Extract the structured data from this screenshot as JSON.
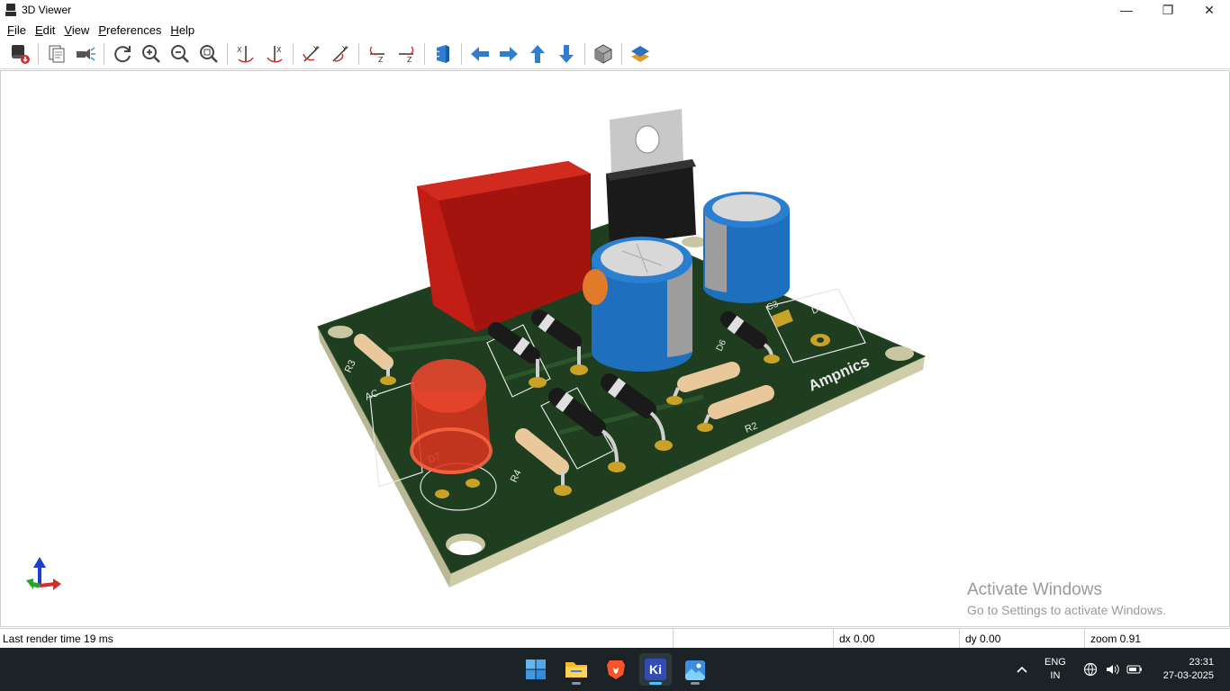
{
  "window": {
    "title": "3D Viewer",
    "controls": {
      "minimize": "—",
      "maximize": "❐",
      "close": "✕"
    }
  },
  "menu": {
    "items": [
      {
        "label": "File",
        "accel": "F",
        "rest": "ile"
      },
      {
        "label": "Edit",
        "accel": "E",
        "rest": "dit"
      },
      {
        "label": "View",
        "accel": "V",
        "rest": "iew"
      },
      {
        "label": "Preferences",
        "accel": "P",
        "rest": "references"
      },
      {
        "label": "Help",
        "accel": "H",
        "rest": "elp"
      }
    ]
  },
  "toolbar": {
    "buttons": [
      "export-icon",
      "copy-icon",
      "raytrace-icon",
      "reload-icon",
      "zoom-in-icon",
      "zoom-out-icon",
      "zoom-fit-icon",
      "rotate-x-cw-icon",
      "rotate-x-ccw-icon",
      "rotate-y-cw-icon",
      "rotate-y-ccw-icon",
      "rotate-z-cw-icon",
      "rotate-z-ccw-icon",
      "flip-board-icon",
      "move-left-icon",
      "move-right-icon",
      "move-up-icon",
      "move-down-icon",
      "orthographic-icon",
      "layers-icon"
    ]
  },
  "board": {
    "silkscreen_brand": "Ampnics",
    "refs": [
      "R3",
      "AC",
      "D7",
      "R4",
      "R2",
      "C3",
      "DC",
      "D6"
    ]
  },
  "watermark": {
    "line1": "Activate Windows",
    "line2": "Go to Settings to activate Windows."
  },
  "status": {
    "render_time": "Last render time 19 ms",
    "dx": "dx 0.00",
    "dy": "dy 0.00",
    "zoom": "zoom 0.91"
  },
  "taskbar": {
    "language_top": "ENG",
    "language_bottom": "IN",
    "time": "23:31",
    "date": "27-03-2025",
    "ki_label": "Ki"
  },
  "colors": {
    "board": "#1f3d1f",
    "board_edge": "#c9c7a1",
    "accent_blue": "#2f7ecf",
    "taskbar": "#1c2327"
  }
}
